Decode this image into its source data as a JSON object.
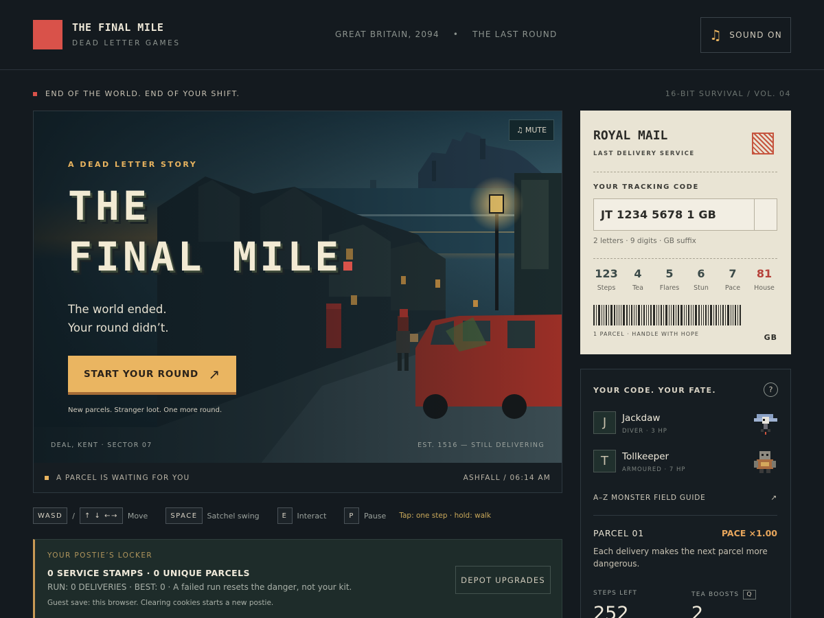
{
  "header": {
    "brand": "THE FINAL MILE",
    "studio": "DEAD LETTER GAMES",
    "setting": "GREAT BRITAIN, 2094",
    "separator": "•",
    "chapter": "THE LAST ROUND",
    "sound_label": "SOUND ON",
    "sound_icon": "music-note-icon"
  },
  "tagline": "END OF THE WORLD. END OF YOUR SHIFT.",
  "series": "16-BIT SURVIVAL / VOL. 04",
  "hero": {
    "mute_label": "MUTE",
    "kicker": "A DEAD LETTER STORY",
    "title_line1": "THE",
    "title_line2": "FINAL MILE",
    "lede_line1": "The world ended.",
    "lede_line2": "Your round didn’t.",
    "cta_label": "START YOUR ROUND",
    "cta_icon": "↗",
    "subnote": "New parcels. Stranger loot. One more round.",
    "location": "DEAL, KENT · SECTOR 07",
    "established": "EST. 1516 — STILL DELIVERING"
  },
  "status": {
    "left": "A PARCEL IS WAITING FOR YOU",
    "right": "ASHFALL / 06:14 AM"
  },
  "controls": {
    "wasd": "WASD",
    "slash": "/",
    "arrows": "↑ ↓ ←→",
    "move": "Move",
    "space": "SPACE",
    "swing": "Satchel swing",
    "e": "E",
    "interact": "Interact",
    "p": "P",
    "pause": "Pause",
    "hint": "Tap: one step · hold: walk"
  },
  "locker": {
    "title": "YOUR POSTIE’S LOCKER",
    "stamps": "0 SERVICE STAMPS · 0 UNIQUE PARCELS",
    "run": "RUN: 0 DELIVERIES · BEST: 0 · A failed run resets the danger, not your kit.",
    "guest": "Guest save: this browser. Clearing cookies starts a new postie.",
    "depot_label": "DEPOT UPGRADES"
  },
  "ticket": {
    "title": "ROYAL MAIL",
    "subtitle": "LAST DELIVERY SERVICE",
    "code_label": "YOUR TRACKING CODE",
    "code_value": "JT 1234 5678 1 GB",
    "code_hint": "2 letters · 9 digits · GB suffix",
    "stats": [
      {
        "value": "123",
        "label": "Steps"
      },
      {
        "value": "4",
        "label": "Tea"
      },
      {
        "value": "5",
        "label": "Flares"
      },
      {
        "value": "6",
        "label": "Stun"
      },
      {
        "value": "7",
        "label": "Pace"
      },
      {
        "value": "81",
        "label": "House"
      }
    ],
    "footer": "1 PARCEL · HANDLE WITH HOPE",
    "suffix": "GB",
    "accent": "#b6423a"
  },
  "fate": {
    "title": "YOUR CODE. YOUR FATE.",
    "help": "?",
    "monsters": [
      {
        "glyph": "J",
        "name": "Jackdaw",
        "meta": "DIVER · 3 HP"
      },
      {
        "glyph": "T",
        "name": "Tollkeeper",
        "meta": "ARMOURED · 7 HP"
      }
    ],
    "guide": "A–Z MONSTER FIELD GUIDE",
    "guide_icon": "↗",
    "parcel": "PARCEL 01",
    "pace": "PACE ×1.00",
    "desc": "Each delivery makes the next parcel more dangerous.",
    "steps_label": "STEPS LEFT",
    "tea_label": "TEA BOOSTS",
    "tea_key": "Q",
    "steps_value": "252",
    "tea_value": "2"
  },
  "colors": {
    "background": "#141a1f",
    "accent_red": "#d9524a",
    "accent_gold": "#eab561",
    "ticket_paper": "#e9e4d4"
  }
}
